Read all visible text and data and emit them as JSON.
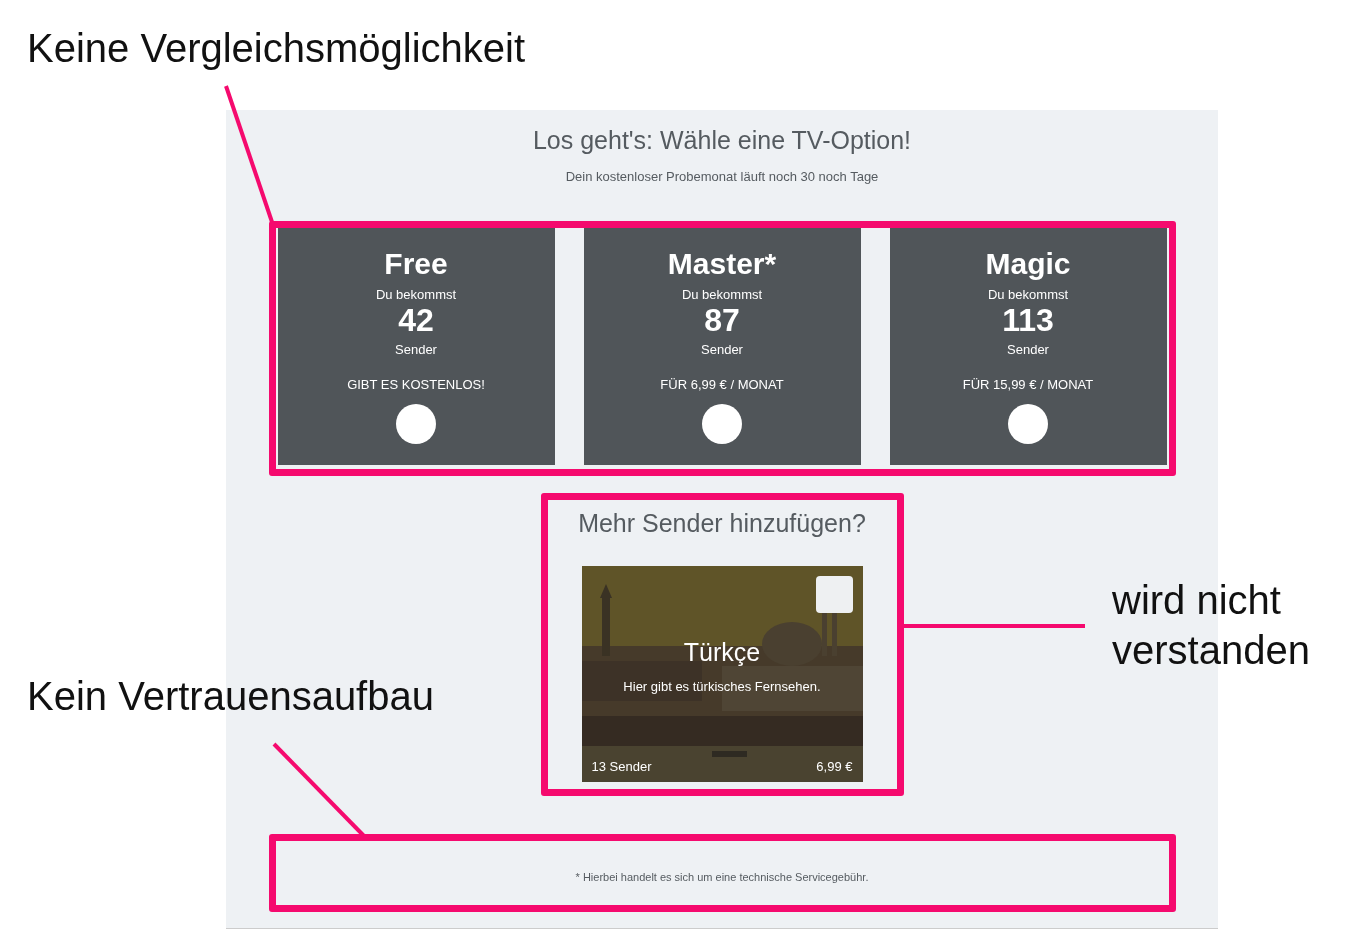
{
  "annotations": [
    {
      "text": "Keine Vergleichsmöglichkeit"
    },
    {
      "text": "wird nicht verstanden"
    },
    {
      "text": "Kein Vertrauensaufbau"
    }
  ],
  "page": {
    "title": "Los geht's: Wähle eine TV-Option!",
    "subtitle": "Dein kostenloser Probemonat läuft noch 30 noch Tage"
  },
  "plans": [
    {
      "name": "Free",
      "intro": "Du bekommst",
      "count": "42",
      "unit": "Sender",
      "price": "GIBT ES KOSTENLOS!",
      "selected": false
    },
    {
      "name": "Master*",
      "intro": "Du bekommst",
      "count": "87",
      "unit": "Sender",
      "price": "FÜR 6,99 € / MONAT",
      "selected": false
    },
    {
      "name": "Magic",
      "intro": "Du bekommst",
      "count": "113",
      "unit": "Sender",
      "price": "FÜR 15,99 € / MONAT",
      "selected": false
    }
  ],
  "addons": {
    "title": "Mehr Sender hinzufügen?",
    "items": [
      {
        "name": "Türkçe",
        "description": "Hier gibt es türkisches Fernsehen.",
        "channels": "13 Sender",
        "price": "6,99 €",
        "checked": false
      }
    ]
  },
  "footnote": "* Hierbei handelt es sich um eine technische Servicegebühr."
}
